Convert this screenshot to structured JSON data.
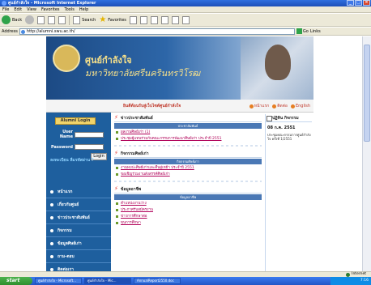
{
  "window": {
    "title": "ศูนย์กำลังใจ - Microsoft Internet Explorer",
    "minimize": "_",
    "maximize": "□",
    "close": "×"
  },
  "menubar": [
    "File",
    "Edit",
    "View",
    "Favorites",
    "Tools",
    "Help"
  ],
  "toolbar": {
    "back_label": "Back",
    "search_label": "Search",
    "favorites_label": "Favorites"
  },
  "address": {
    "label": "Address",
    "value": "http://alumni.swu.ac.th/",
    "go_label": "Go",
    "links_label": "Links"
  },
  "banner": {
    "title": "ศูนย์กำลังใจ",
    "subtitle": "มหาวิทยาลัยศรีนครินทรวิโรฒ"
  },
  "strip": {
    "title": "ยินดีต้อนรับสู่เว็บไซต์ศูนย์กำลังใจ",
    "links": [
      "หน้าแรก",
      "ติดต่อ",
      "English"
    ]
  },
  "login": {
    "header": "Alumni Login",
    "username_label": "User Name",
    "password_label": "Password",
    "button_label": "Login",
    "help_text": "ลงทะเบียน ลืมรหัสผ่าน ?"
  },
  "sidebar_menu": [
    "หน้าแรก",
    "เกี่ยวกับศูนย์",
    "ข่าวประชาสัมพันธ์",
    "กิจกรรม",
    "ข้อมูลศิษย์เก่า",
    "ถาม-ตอบ",
    "ติดต่อเรา"
  ],
  "sections": [
    {
      "title": "ข่าวประชาสัมพันธ์",
      "bar": "ประชาสัมพันธ์",
      "items": [
        "ผลงานศิษย์เก่า (1)",
        "ประชุมผู้แทนร่วมกับคณะกรรมการพัฒนาศิษย์เก่า ประจำปี 2551"
      ]
    },
    {
      "title": "กิจกรรมศิษย์เก่า",
      "bar": "กิจกรรมศิษย์เก่า",
      "items": [
        "งานพบปะศิษย์เก่าและคืนสู่เหย้า ประจำปี 2551",
        "ขอเชิญร่วมงานสังสรรค์ศิษย์เก่า"
      ]
    },
    {
      "title": "ข้อมูลอาชีพ",
      "bar": "ข้อมูลอาชีพ",
      "items": [
        "ตำแหน่งงานว่าง",
        "ประกาศรับสมัครงาน",
        "ข่าวการศึกษาต่อ",
        "ทุนการศึกษา"
      ]
    }
  ],
  "activity": {
    "title": "ปฏิทิน กิจกรรม",
    "date": "08 ก.ค. 2551",
    "text": "ประชุมคณะกรรมการศูนย์กำลังใจ ครั้งที่ 1/2551"
  },
  "statusbar": {
    "zone": "Internet"
  },
  "taskbar": {
    "start": "start",
    "tasks": [
      "ศูนย์กำลังใจ - Microsoft...",
      "ศูนย์กำลังใจ - Mic...",
      "AnnualReport2550.doc"
    ],
    "clock": "7:16"
  }
}
